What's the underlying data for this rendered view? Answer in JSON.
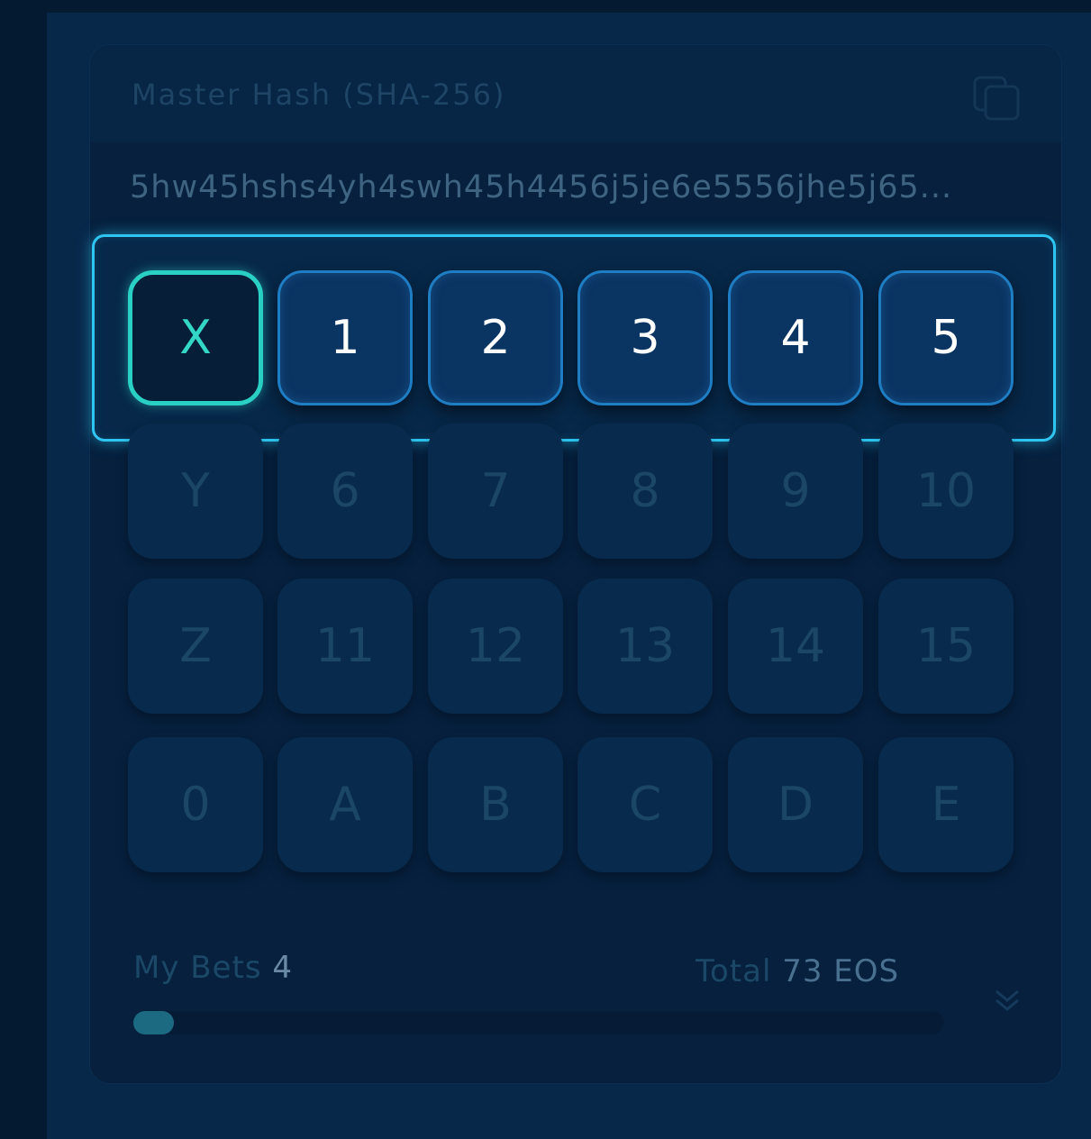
{
  "hash": {
    "title": "Master Hash (SHA-256)",
    "value": "5hw45hshs4yh4swh45h4456j5je6e5556jhe5j65..."
  },
  "grid": {
    "rows": [
      [
        "X",
        "1",
        "2",
        "3",
        "4",
        "5"
      ],
      [
        "Y",
        "6",
        "7",
        "8",
        "9",
        "10"
      ],
      [
        "Z",
        "11",
        "12",
        "13",
        "14",
        "15"
      ],
      [
        "0",
        "A",
        "B",
        "C",
        "D",
        "E"
      ]
    ],
    "selected_cell": "X"
  },
  "footer": {
    "my_bets_label": "My Bets",
    "my_bets_value": "4",
    "total_label": "Total",
    "total_value": "73 EOS",
    "progress_fraction": 0.05
  },
  "icons": {
    "copy": "copy-icon",
    "expand": "chevron-down-icon"
  },
  "colors": {
    "background": "#07223c",
    "card": "#06203e",
    "highlight_border": "#2ec6f0",
    "selected_border": "#2ad0c3",
    "active_cell": "#0a3462",
    "dim_text": "#1c4666"
  }
}
